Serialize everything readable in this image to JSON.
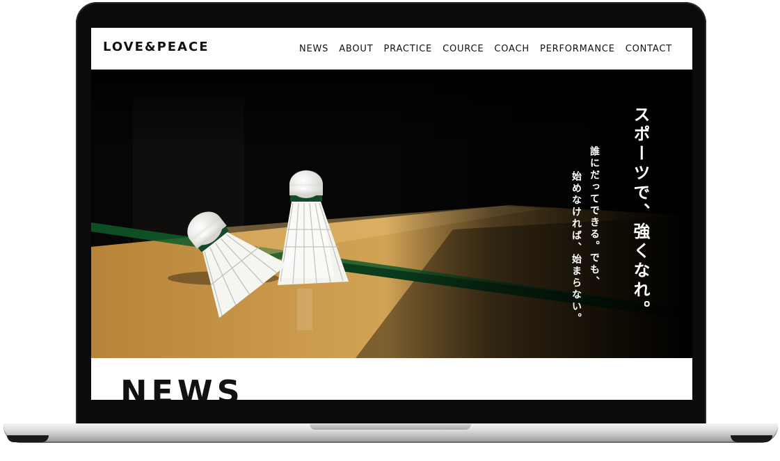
{
  "brand": {
    "logo": "LOVE&PEACE"
  },
  "nav": {
    "items": [
      {
        "label": "NEWS"
      },
      {
        "label": "ABOUT"
      },
      {
        "label": "PRACTICE"
      },
      {
        "label": "COURCE"
      },
      {
        "label": "COACH"
      },
      {
        "label": "PERFORMANCE"
      },
      {
        "label": "CONTACT"
      }
    ]
  },
  "hero": {
    "headline": "スポーツで、強くなれ。",
    "subline_1": "誰にだってできる。でも、",
    "subline_2": "始めなければ、始まらない。"
  },
  "news": {
    "title": "NEWS"
  },
  "colors": {
    "screen_background": "#ffffff",
    "hero_background": "#050505",
    "floor": "#c8963e",
    "court_line": "#0f5a2a",
    "text_dark": "#111111",
    "text_light": "#ffffff"
  }
}
